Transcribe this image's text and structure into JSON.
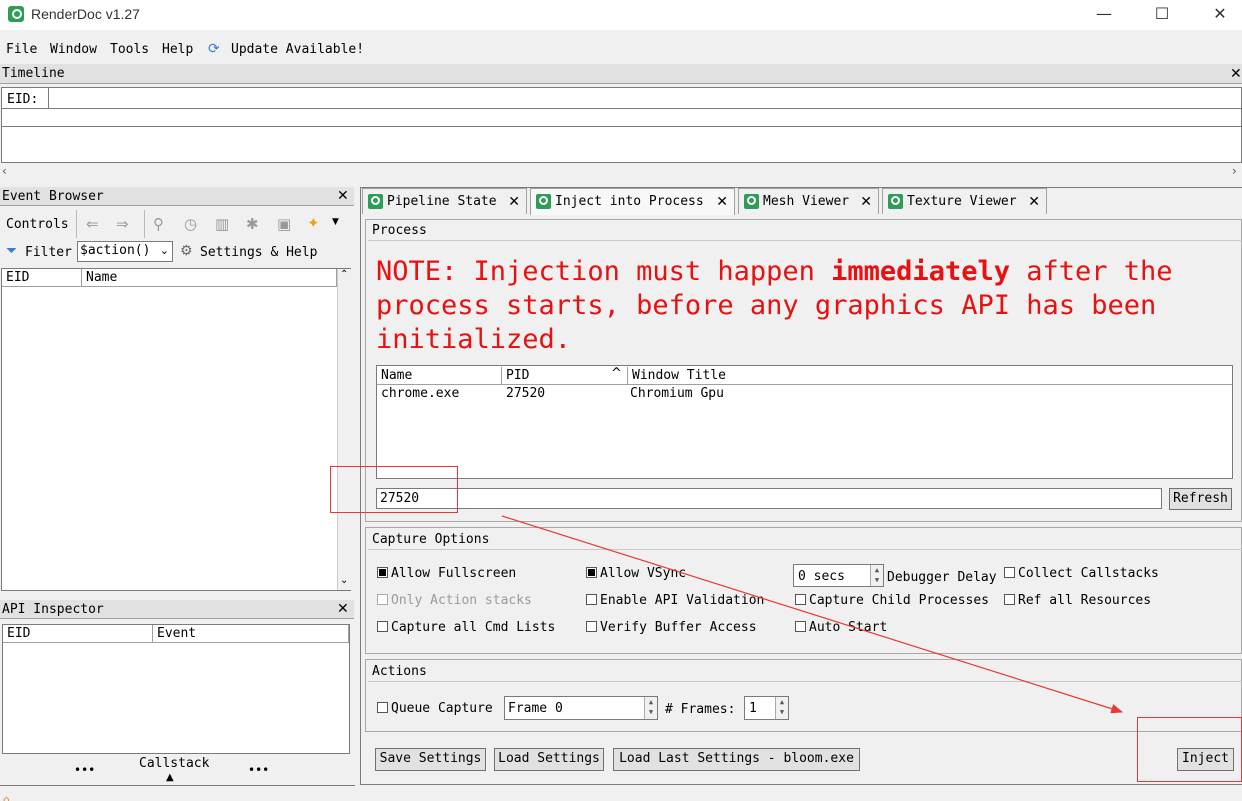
{
  "window": {
    "title": "RenderDoc v1.27",
    "minimize": "—",
    "maximize": "☐",
    "close": "✕"
  },
  "menu": {
    "file": "File",
    "window": "Window",
    "tools": "Tools",
    "help": "Help",
    "update": "Update Available!"
  },
  "timeline": {
    "title": "Timeline",
    "eid_label": "EID:"
  },
  "event_browser": {
    "title": "Event Browser",
    "controls_label": "Controls",
    "filter_label": "Filter",
    "filter_value": "$action()",
    "settings_label": "Settings & Help",
    "columns": [
      "EID",
      "Name"
    ]
  },
  "api_inspector": {
    "title": "API Inspector",
    "columns": [
      "EID",
      "Event"
    ],
    "callstack_label": "Callstack",
    "dots": "•••"
  },
  "tabs": [
    {
      "label": "Pipeline State"
    },
    {
      "label": "Inject into Process"
    },
    {
      "label": "Mesh Viewer"
    },
    {
      "label": "Texture Viewer"
    }
  ],
  "process": {
    "group_title": "Process",
    "note_prefix": "NOTE: Injection must happen ",
    "note_bold": "immediately",
    "note_after": " after the",
    "note_line2": "process starts, before any graphics API has been",
    "note_line3": "initialized.",
    "columns": [
      "Name",
      "PID",
      "Window Title"
    ],
    "rows": [
      {
        "name": "chrome.exe",
        "pid": "27520",
        "title": "Chromium Gpu"
      }
    ],
    "filter_value": "27520",
    "refresh_label": "Refresh"
  },
  "capture_options": {
    "group_title": "Capture Options",
    "allow_fullscreen": "Allow Fullscreen",
    "allow_vsync": "Allow VSync",
    "delay_value": "0 secs",
    "debugger_delay": "Debugger Delay",
    "collect_callstacks": "Collect Callstacks",
    "only_action_stacks": "Only Action stacks",
    "enable_api_validation": "Enable API Validation",
    "capture_child": "Capture Child Processes",
    "ref_all_resources": "Ref all Resources",
    "capture_all_cmd": "Capture all Cmd Lists",
    "verify_buffer": "Verify Buffer Access",
    "auto_start": "Auto Start"
  },
  "actions": {
    "group_title": "Actions",
    "queue_capture": "Queue Capture",
    "frame_value": "Frame 0",
    "frames_label": "# Frames:",
    "frames_value": "1"
  },
  "bottom": {
    "save_settings": "Save Settings",
    "load_settings": "Load Settings",
    "load_last": "Load Last Settings - bloom.exe",
    "inject": "Inject"
  },
  "colors": {
    "note_red": "#e81010",
    "annotation_red": "#e53935",
    "accent_green": "#2e9e55"
  }
}
